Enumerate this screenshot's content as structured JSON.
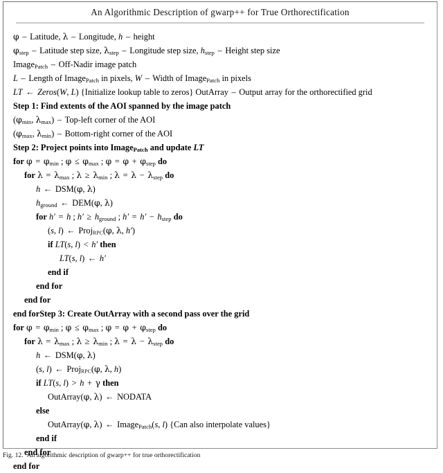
{
  "figure": {
    "title": "An Algorithmic Description of gwarp++ for True Orthorectification",
    "caption_label": "Fig. 12.",
    "caption_text": "An algorithmic description of gwarp++ for true orthorectification",
    "border_color": "#8c8c8c",
    "rule_color": "#c9c9c9",
    "text_color": "#000000"
  },
  "algorithm": {
    "lines": [
      {
        "id": "def-phi-lambda-h",
        "indent": 0,
        "plain": "φ – Latitude, λ – Longitude, h – height"
      },
      {
        "id": "def-step-sizes",
        "indent": 0,
        "plain": "φstep – Latitude step size, λstep – Longitude step size, hstep – Height step size"
      },
      {
        "id": "def-image-patch",
        "indent": 0,
        "plain": "ImagePatch – Off-Nadir image patch"
      },
      {
        "id": "def-length-width",
        "indent": 0,
        "plain": "L – Length of ImagePatch in pixels, W – Width of ImagePatch in pixels"
      },
      {
        "id": "init-lookup-table",
        "indent": 0,
        "plain": "LT ← Zeros(W, L) {Initialize lookup table to zeros} OutArray – Output array for the orthorectified grid"
      },
      {
        "id": "step1-heading",
        "indent": 0,
        "plain": "Step 1: Find extents of the AOI spanned by the image patch"
      },
      {
        "id": "aoi-top-left",
        "indent": 0,
        "plain": "(φmin, λmax) – Top-left corner of the AOI"
      },
      {
        "id": "aoi-bottom-right",
        "indent": 0,
        "plain": "(φmax, λmin) – Bottom-right corner of the AOI"
      },
      {
        "id": "step2-heading",
        "indent": 0,
        "plain": "Step 2: Project points into ImagePatch and update LT"
      },
      {
        "id": "s2-for-phi",
        "indent": 0,
        "plain": "for φ = φmin ; φ ≤ φmax ; φ = φ + φstep do"
      },
      {
        "id": "s2-for-lambda",
        "indent": 1,
        "plain": "for λ = λmax ; λ ≥ λmin ; λ = λ − λstep do"
      },
      {
        "id": "s2-h-dsm",
        "indent": 2,
        "plain": "h ← DSM(φ, λ)"
      },
      {
        "id": "s2-hground-dem",
        "indent": 2,
        "plain": "hground ← DEM(φ, λ)"
      },
      {
        "id": "s2-for-hprime",
        "indent": 2,
        "plain": "for h′ = h ; h′ ≥ hground ; h′ = h′ − hstep do"
      },
      {
        "id": "s2-proj-rpc",
        "indent": 3,
        "plain": "(s, l) ← ProjRPC(φ, λ, h′)"
      },
      {
        "id": "s2-if-lt-less",
        "indent": 3,
        "plain": "if LT(s, l) < h′ then"
      },
      {
        "id": "s2-assign-lt",
        "indent": 4,
        "plain": "LT(s, l) ← h′"
      },
      {
        "id": "s2-end-if",
        "indent": 3,
        "plain": "end if"
      },
      {
        "id": "s2-end-for-inner",
        "indent": 2,
        "plain": "end for"
      },
      {
        "id": "s2-end-for-lambda",
        "indent": 1,
        "plain": "end for"
      },
      {
        "id": "s2-end-for-step3-heading",
        "indent": 0,
        "plain": "end forStep 3: Create OutArray with a second pass over the grid"
      },
      {
        "id": "s3-for-phi",
        "indent": 0,
        "plain": "for φ = φmin ; φ ≤ φmax ; φ = φ + φstep do"
      },
      {
        "id": "s3-for-lambda",
        "indent": 1,
        "plain": "for λ = λmax ; λ ≥ λmin ; λ = λ − λstep do"
      },
      {
        "id": "s3-h-dsm",
        "indent": 2,
        "plain": "h ← DSM(φ, λ)"
      },
      {
        "id": "s3-proj-rpc",
        "indent": 2,
        "plain": "(s, l) ← ProjRPC(φ, λ, h)"
      },
      {
        "id": "s3-if-lt-greater",
        "indent": 2,
        "plain": "if LT(s, l) > h + γ then"
      },
      {
        "id": "s3-outarray-nodata",
        "indent": 3,
        "plain": "OutArray(φ, λ) ← NODATA"
      },
      {
        "id": "s3-else",
        "indent": 2,
        "plain": "else"
      },
      {
        "id": "s3-outarray-image",
        "indent": 3,
        "plain": "OutArray(φ, λ) ← ImagePatch(s, l) {Can also interpolate values}"
      },
      {
        "id": "s3-end-if",
        "indent": 2,
        "plain": "end if"
      },
      {
        "id": "s3-end-for-lambda",
        "indent": 1,
        "plain": "end for"
      },
      {
        "id": "s3-end-for-phi",
        "indent": 0,
        "plain": "end for"
      }
    ],
    "symbols": {
      "phi": "φ",
      "lambda": "λ",
      "gamma": "γ",
      "gets": "←",
      "le": "≤",
      "ge": "≥",
      "minus": "−",
      "dash": "–",
      "prime": "′"
    },
    "keywords": [
      "for",
      "do",
      "if",
      "then",
      "else",
      "end if",
      "end for"
    ],
    "step_headings": [
      "Step 1: Find extents of the AOI spanned by the image patch",
      "Step 2: Project points into ImagePatch and update LT",
      "Step 3: Create OutArray with a second pass over the grid"
    ]
  }
}
